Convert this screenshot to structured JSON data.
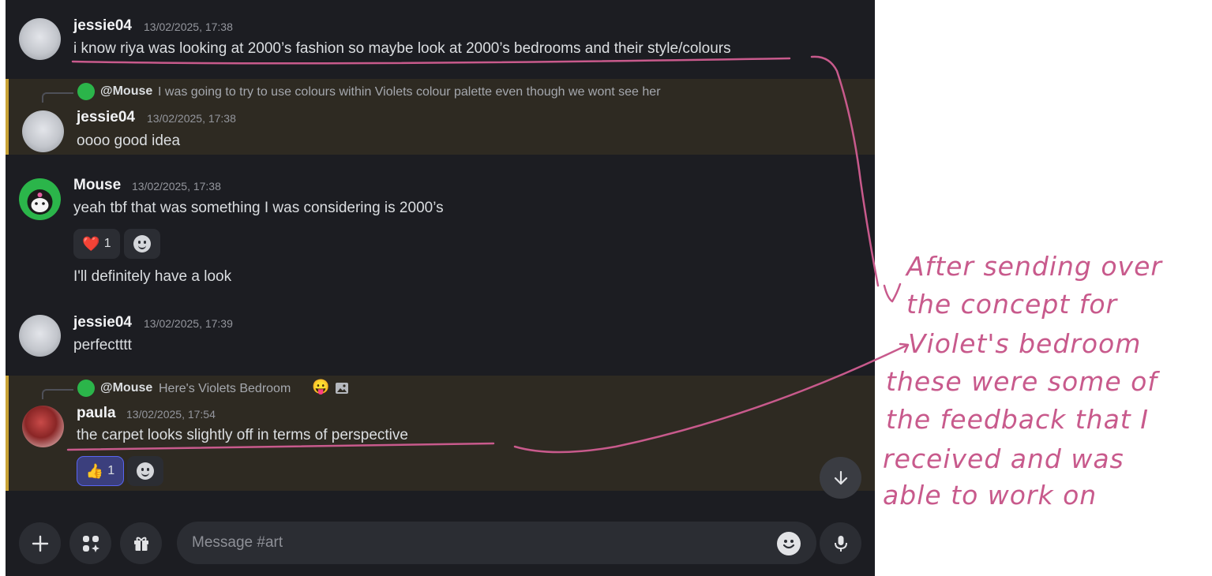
{
  "messages": [
    {
      "id": "m1",
      "username": "jessie04",
      "timestamp": "13/02/2025, 17:38",
      "text": "i know riya was looking at 2000’s fashion so maybe look at 2000’s bedrooms and their style/colours"
    },
    {
      "id": "m2",
      "username": "jessie04",
      "timestamp": "13/02/2025, 17:38",
      "text": "oooo good idea",
      "reply": {
        "name": "@Mouse",
        "text": "I was going to try to use colours within Violets colour palette even  though we wont see her"
      }
    },
    {
      "id": "m3",
      "username": "Mouse",
      "timestamp": "13/02/2025, 17:38",
      "text": "yeah tbf that was something I was considering is 2000’s",
      "reaction": {
        "emoji": "❤️",
        "count": "1"
      },
      "followup": "I'll definitely have a look"
    },
    {
      "id": "m4",
      "username": "jessie04",
      "timestamp": "13/02/2025, 17:39",
      "text": "perfectttt"
    },
    {
      "id": "m5",
      "username": "paula",
      "timestamp": "13/02/2025, 17:54",
      "text": "the carpet looks slightly off in terms of perspective",
      "reply": {
        "name": "@Mouse",
        "text": "Here's Violets Bedroom",
        "emoji": "😛"
      },
      "reaction": {
        "emoji": "👍",
        "count": "1"
      }
    }
  ],
  "composer": {
    "placeholder": "Message #art"
  },
  "colors": {
    "background": "#1c1d22",
    "mention_bg": "#2e2a22",
    "mention_border": "#c8a235",
    "annotation": "#c85a8c"
  },
  "annotation": {
    "lines": [
      "After sending over",
      "the concept for",
      "Violet's bedroom",
      "these were some of",
      "the feedback that I",
      "received and was",
      "able to work on"
    ]
  },
  "icons": [
    "plus-icon",
    "apps-icon",
    "gift-icon",
    "emoji-icon",
    "mic-icon",
    "arrow-down-icon",
    "image-icon"
  ]
}
